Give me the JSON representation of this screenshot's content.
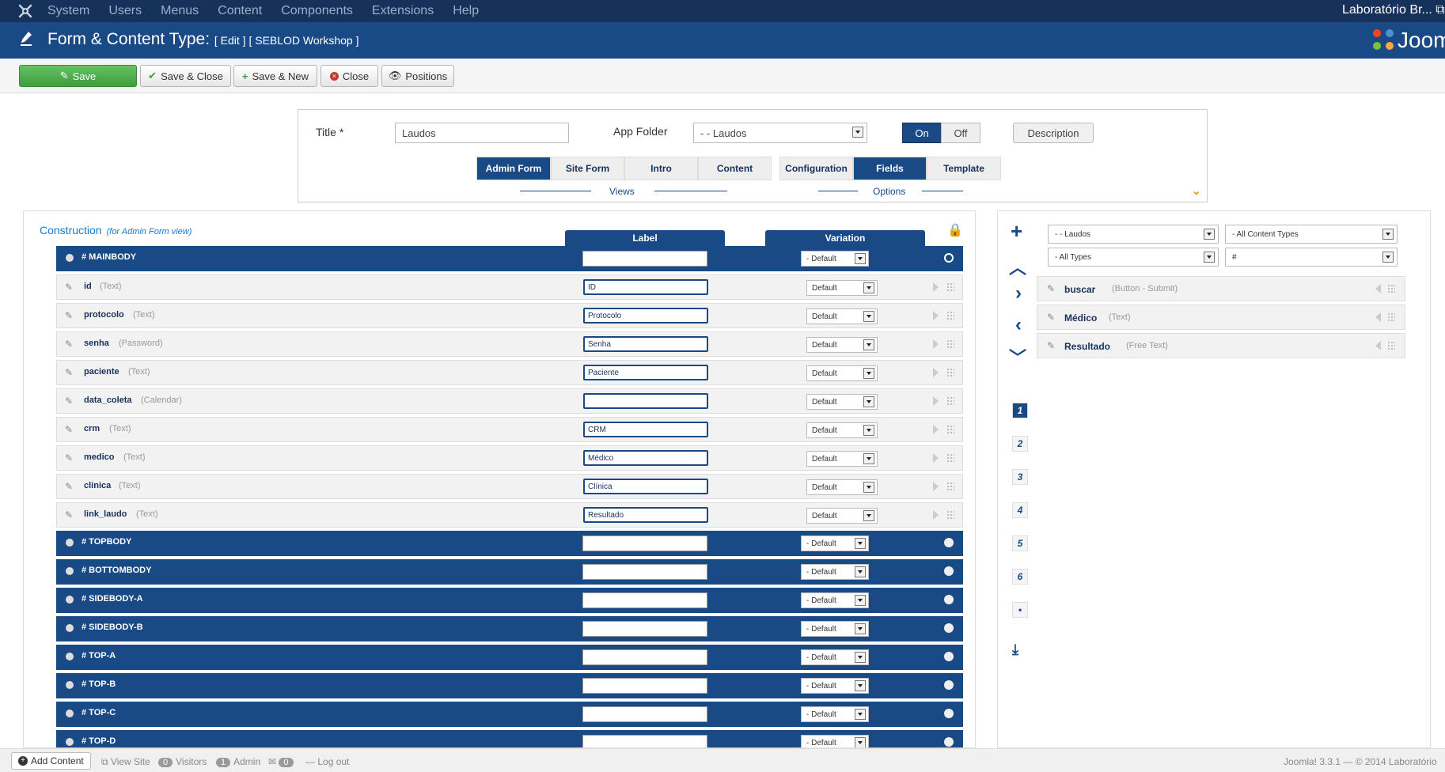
{
  "menubar": {
    "items": [
      "System",
      "Users",
      "Menus",
      "Content",
      "Components",
      "Extensions",
      "Help"
    ],
    "site_name": "Laboratório Br... ⧉"
  },
  "header": {
    "title": "Form & Content Type:",
    "subtitle": "[ Edit ] [ SEBLOD Workshop ]",
    "logo_text": "Joomla"
  },
  "toolbar": {
    "save": "Save",
    "save_close": "Save & Close",
    "save_new": "Save & New",
    "close": "Close",
    "positions": "Positions"
  },
  "form": {
    "title_label": "Title",
    "required_mark": "*",
    "title_value": "Laudos",
    "app_folder_label": "App Folder",
    "app_folder_value": "- - Laudos",
    "on": "On",
    "off": "Off",
    "description": "Description",
    "views_tabs": [
      "Admin Form",
      "Site Form",
      "Intro",
      "Content"
    ],
    "views_label": "Views",
    "options_tabs": [
      "Configuration",
      "Fields",
      "Template"
    ],
    "options_label": "Options"
  },
  "construction": {
    "title": "Construction",
    "subtitle": "(for Admin Form view)",
    "col_label": "Label",
    "col_variation": "Variation",
    "mainbody": {
      "name": "# MAINBODY",
      "variation": "- Default"
    },
    "fields": [
      {
        "name": "id",
        "type": "(Text)",
        "label": "ID",
        "variation": "Default"
      },
      {
        "name": "protocolo",
        "type": "(Text)",
        "label": "Protocolo",
        "variation": "Default"
      },
      {
        "name": "senha",
        "type": "(Password)",
        "label": "Senha",
        "variation": "Default"
      },
      {
        "name": "paciente",
        "type": "(Text)",
        "label": "Paciente",
        "variation": "Default"
      },
      {
        "name": "data_coleta",
        "type": "(Calendar)",
        "label": "",
        "variation": "Default"
      },
      {
        "name": "crm",
        "type": "(Text)",
        "label": "CRM",
        "variation": "Default"
      },
      {
        "name": "medico",
        "type": "(Text)",
        "label": "Médico",
        "variation": "Default"
      },
      {
        "name": "clinica",
        "type": "(Text)",
        "label": "Clínica",
        "variation": "Default"
      },
      {
        "name": "link_laudo",
        "type": "(Text)",
        "label": "Resultado",
        "variation": "Default"
      }
    ],
    "positions": [
      {
        "name": "# TOPBODY",
        "variation": "- Default"
      },
      {
        "name": "# BOTTOMBODY",
        "variation": "- Default"
      },
      {
        "name": "# SIDEBODY-A",
        "variation": "- Default"
      },
      {
        "name": "# SIDEBODY-B",
        "variation": "- Default"
      },
      {
        "name": "# TOP-A",
        "variation": "- Default"
      },
      {
        "name": "# TOP-B",
        "variation": "- Default"
      },
      {
        "name": "# TOP-C",
        "variation": "- Default"
      },
      {
        "name": "# TOP-D",
        "variation": "- Default"
      }
    ]
  },
  "right": {
    "filter_folder": "- - Laudos",
    "filter_content_types": "- All Content Types",
    "filter_types": "- All Types",
    "filter_hash": "#",
    "pages": [
      "1",
      "2",
      "3",
      "4",
      "5",
      "6",
      "•"
    ],
    "fields": [
      {
        "name": "buscar",
        "type": "(Button - Submit)"
      },
      {
        "name": "Médico",
        "type": "(Text)"
      },
      {
        "name": "Resultado",
        "type": "(Free Text)"
      }
    ]
  },
  "statusbar": {
    "add_content": "Add Content",
    "view_site": "View Site",
    "visitors_count": "0",
    "visitors": "Visitors",
    "admin_count": "1",
    "admin": "Admin",
    "messages_count": "0",
    "logout": "Log out",
    "version": "Joomla! 3.3.1 — © 2014 Laboratório"
  },
  "colors": {
    "navy": "#17325a",
    "blue": "#1a4a85",
    "green": "#3f9b3f",
    "link": "#1a7ac8",
    "orange": "#e8941a"
  }
}
